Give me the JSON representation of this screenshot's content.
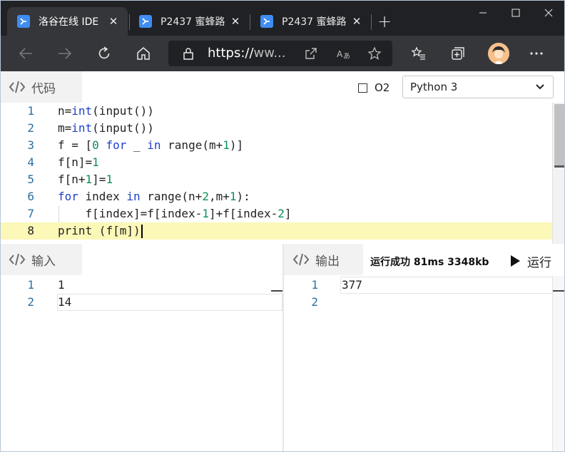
{
  "browser": {
    "tabs": [
      {
        "title": "洛谷在线 IDE",
        "active": true
      },
      {
        "title": "P2437 蜜蜂路",
        "active": false
      },
      {
        "title": "P2437 蜜蜂路",
        "active": false
      }
    ],
    "new_tab_label": "+",
    "url_prefix": "https://",
    "url_rest": "ww...",
    "window_controls": [
      "minimize-icon",
      "maximize-icon",
      "close-icon"
    ],
    "toolbar_icons": [
      "back-icon",
      "forward-icon",
      "refresh-icon",
      "home-icon",
      "lock-icon",
      "open-in-app-icon",
      "read-aloud-icon",
      "favorite-star-icon",
      "favorites-list-icon",
      "collections-icon",
      "profile-avatar",
      "more-icon"
    ],
    "colors": {
      "chrome_dark": "#202124",
      "chrome_mid": "#35363a",
      "favicon": "#3f8df2"
    }
  },
  "code_panel": {
    "title": "代码",
    "o2_label": "O2",
    "o2_checked": false,
    "language": "Python 3",
    "current_line": 8,
    "lines": [
      {
        "n": "1",
        "tokens": [
          {
            "t": "n=",
            "c": ""
          },
          {
            "t": "int",
            "c": "kw"
          },
          {
            "t": "(input())",
            "c": ""
          }
        ]
      },
      {
        "n": "2",
        "tokens": [
          {
            "t": "m=",
            "c": ""
          },
          {
            "t": "int",
            "c": "kw"
          },
          {
            "t": "(input())",
            "c": ""
          }
        ]
      },
      {
        "n": "3",
        "tokens": [
          {
            "t": "f = [",
            "c": ""
          },
          {
            "t": "0",
            "c": "num"
          },
          {
            "t": " ",
            "c": ""
          },
          {
            "t": "for",
            "c": "kw"
          },
          {
            "t": " _ ",
            "c": ""
          },
          {
            "t": "in",
            "c": "kw"
          },
          {
            "t": " range(m+",
            "c": ""
          },
          {
            "t": "1",
            "c": "num"
          },
          {
            "t": ")]",
            "c": ""
          }
        ]
      },
      {
        "n": "4",
        "tokens": [
          {
            "t": "f[n]=",
            "c": ""
          },
          {
            "t": "1",
            "c": "num"
          }
        ]
      },
      {
        "n": "5",
        "tokens": [
          {
            "t": "f[n+",
            "c": ""
          },
          {
            "t": "1",
            "c": "num"
          },
          {
            "t": "]=",
            "c": ""
          },
          {
            "t": "1",
            "c": "num"
          }
        ]
      },
      {
        "n": "6",
        "tokens": [
          {
            "t": "for",
            "c": "kw"
          },
          {
            "t": " index ",
            "c": ""
          },
          {
            "t": "in",
            "c": "kw"
          },
          {
            "t": " range(n+",
            "c": ""
          },
          {
            "t": "2",
            "c": "num"
          },
          {
            "t": ",m+",
            "c": ""
          },
          {
            "t": "1",
            "c": "num"
          },
          {
            "t": "):",
            "c": ""
          }
        ]
      },
      {
        "n": "7",
        "tokens": [
          {
            "t": "    f[index]=f[index-",
            "c": ""
          },
          {
            "t": "1",
            "c": "num"
          },
          {
            "t": "]+f[index-",
            "c": ""
          },
          {
            "t": "2",
            "c": "num"
          },
          {
            "t": "]",
            "c": ""
          }
        ]
      },
      {
        "n": "8",
        "tokens": [
          {
            "t": "print",
            "c": ""
          },
          {
            "t": " (f[m])",
            "c": ""
          }
        ]
      }
    ],
    "colors": {
      "keyword": "#1f3fc9",
      "number": "#0a8f55",
      "current_line": "#fbf8b8",
      "line_number": "#2b6fa0"
    }
  },
  "input_panel": {
    "title": "输入",
    "lines": [
      {
        "n": "1",
        "text": "1"
      },
      {
        "n": "2",
        "text": "14"
      }
    ]
  },
  "output_panel": {
    "title": "输出",
    "status": "运行成功 81ms 3348kb",
    "run_label": "运行",
    "lines": [
      {
        "n": "1",
        "text": "377"
      },
      {
        "n": "2",
        "text": ""
      }
    ]
  }
}
